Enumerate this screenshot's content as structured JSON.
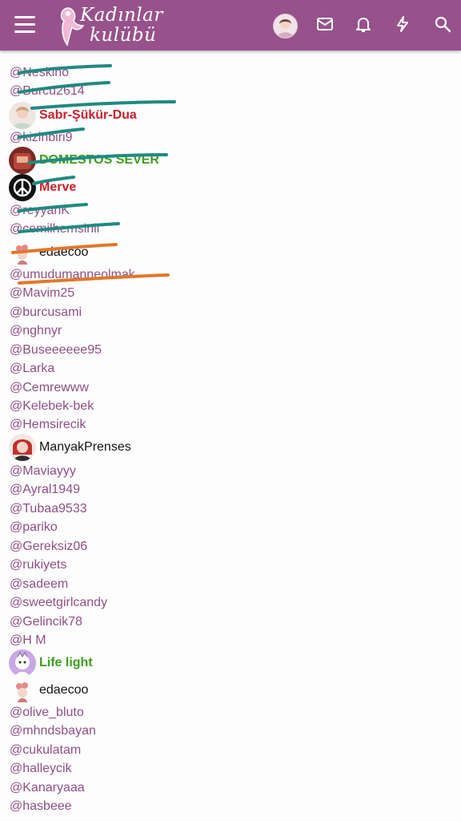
{
  "header": {
    "logo_line1": "Kadınlar",
    "logo_line2": "kulübü",
    "icons": [
      "menu-icon",
      "avatar",
      "envelope-icon",
      "bell-icon",
      "bolt-icon",
      "search-icon"
    ]
  },
  "colors": {
    "header_bg": "#97528c",
    "mention": "#8f4f86",
    "name_red": "#c8202c",
    "name_green": "#3e9d1c",
    "strike_teal": "#1f8a82",
    "strike_orange": "#e0782a"
  },
  "list": {
    "mentions": [
      "@Neskino",
      "@Burcu2614",
      "@kizinbiri9",
      "@reyyanK",
      "@cemilhemsinli",
      "@umudumanneolmak",
      "@Mavim25",
      "@burcusami",
      "@nghnyr",
      "@Buseeeeee95",
      "@Larka",
      "@Cemrewww",
      "@Kelebek-bek",
      "@Hemsirecik",
      "@Maviayyy",
      "@Ayral1949",
      "@Tubaa9533",
      "@pariko",
      "@Gereksiz06",
      "@rukiyets",
      "@sadeem",
      "@sweetgirlcandy",
      "@Gelincik78",
      "@H M",
      "@olive_bluto",
      "@mhndsbayan",
      "@cukulatam",
      "@halleycik",
      "@Kanaryaaa",
      "@hasbeee"
    ],
    "users": [
      "Sabr-Şükür-Dua",
      "DOMESTOS SEVER",
      "Merve",
      "edaecoo",
      "ManyakPrenses",
      "Life light",
      "edaecoo"
    ]
  }
}
